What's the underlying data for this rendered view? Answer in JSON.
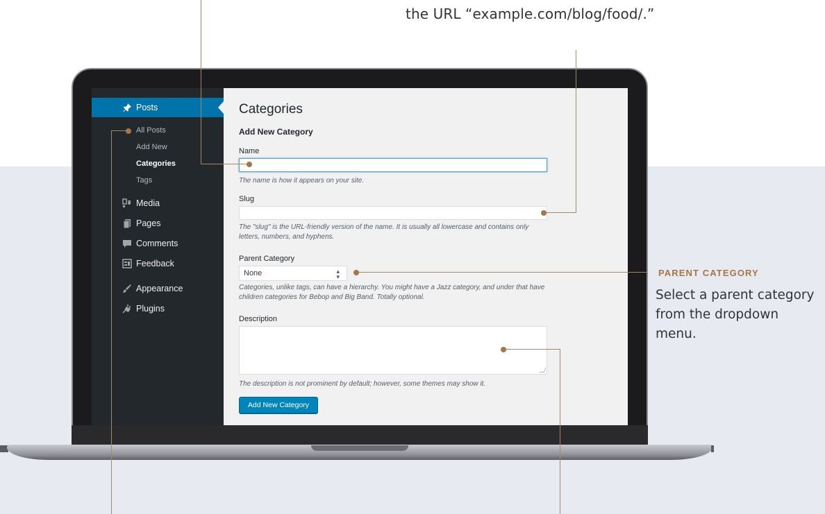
{
  "top_caption": "the URL “example.com/blog/food/.”",
  "callout": {
    "heading": "PARENT CATEGORY",
    "text": "Select a parent category from the dropdown menu."
  },
  "sidebar": {
    "posts_label": "Posts",
    "subitems": [
      "All Posts",
      "Add New",
      "Categories",
      "Tags"
    ],
    "menu": [
      "Media",
      "Pages",
      "Comments",
      "Feedback",
      "Appearance",
      "Plugins"
    ]
  },
  "form": {
    "page_title": "Categories",
    "section_title": "Add New Category",
    "name_label": "Name",
    "name_value": "",
    "name_help": "The name is how it appears on your site.",
    "slug_label": "Slug",
    "slug_value": "",
    "slug_help": "The \"slug\" is the URL-friendly version of the name. It is usually all lowercase and contains only letters, numbers, and hyphens.",
    "parent_label": "Parent Category",
    "parent_selected": "None",
    "parent_help": "Categories, unlike tags, can have a hierarchy. You might have a Jazz category, and under that have children categories for Bebop and Big Band. Totally optional.",
    "description_label": "Description",
    "description_value": "",
    "description_help": "The description is not prominent by default; however, some themes may show it.",
    "submit_label": "Add New Category"
  },
  "colors": {
    "admin_sidebar": "#23282d",
    "admin_accent": "#0073aa",
    "callout_accent": "#a87449"
  }
}
